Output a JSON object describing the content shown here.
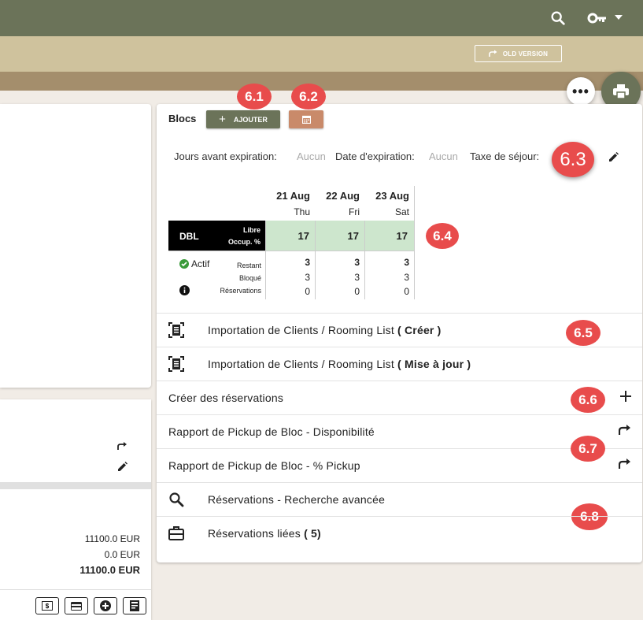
{
  "topbar": {
    "search_icon": "search-icon",
    "key_icon": "key-icon",
    "menu_icon": "caret-down-icon",
    "old_version_label": "OLD VERSION"
  },
  "fab": {
    "more_label": "•••",
    "print_icon": "print-icon"
  },
  "blocs": {
    "title": "Blocs",
    "add_label": "AJOUTER",
    "calendar_icon": "calendar-icon",
    "jours_label": "Jours avant expiration:",
    "jours_value": "Aucun",
    "date_label": "Date d'expiration:",
    "date_value": "Aucun",
    "taxe_label": "Taxe de séjour:"
  },
  "grid": {
    "days": [
      {
        "date": "21 Aug",
        "weekday": "Thu",
        "libre": "17",
        "restant": "3",
        "bloque": "3",
        "reservations": "0"
      },
      {
        "date": "22 Aug",
        "weekday": "Fri",
        "libre": "17",
        "restant": "3",
        "bloque": "3",
        "reservations": "0"
      },
      {
        "date": "23 Aug",
        "weekday": "Sat",
        "libre": "17",
        "restant": "3",
        "bloque": "3",
        "reservations": "0"
      }
    ],
    "room_type": "DBL",
    "libre_label": "Libre",
    "occup_label": "Occup. %",
    "status_label": "Actif",
    "restant_label": "Restant",
    "bloque_label": "Bloqué",
    "reservations_label": "Réservations"
  },
  "actions": {
    "import_create_prefix": "Importation de Clients / Rooming List",
    "import_create_bold": "( Créer )",
    "import_update_prefix": "Importation de Clients / Rooming List",
    "import_update_bold": "( Mise à jour )",
    "create_reservations": "Créer des réservations",
    "pickup_dispo": "Rapport de Pickup de Bloc - Disponibilité",
    "pickup_pct": "Rapport de Pickup de Bloc - % Pickup",
    "search_advanced": "Réservations - Recherche avancée",
    "linked_prefix": "Réservations liées",
    "linked_count": "( 5)"
  },
  "badges": {
    "b61": "6.1",
    "b62": "6.2",
    "b63": "6.3",
    "b64": "6.4",
    "b65": "6.5",
    "b66": "6.6",
    "b67": "6.7",
    "b68": "6.8"
  },
  "left_panel": {
    "amount1": "11100.0 EUR",
    "amount2": "0.0 EUR",
    "amount_total": "11100.0 EUR"
  },
  "colors": {
    "topbar": "#6b7359",
    "band1": "#cfc29d",
    "band2": "#a48e6c",
    "badge": "#e84c4c",
    "available": "#cde6cd",
    "calendar_btn": "#c98a6a"
  }
}
